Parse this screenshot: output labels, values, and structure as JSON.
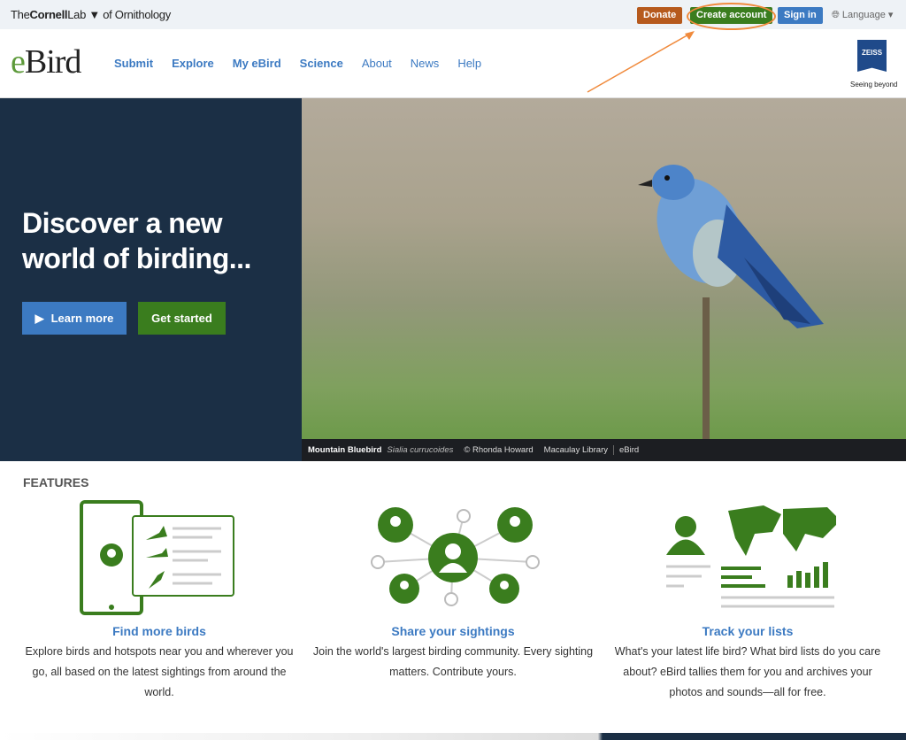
{
  "topbar": {
    "org_pre": "The",
    "org_bold": "Cornell",
    "org_lab": "Lab",
    "org_post": "of Ornithology",
    "donate": "Donate",
    "create_account": "Create account",
    "sign_in": "Sign in",
    "language": "Language"
  },
  "header": {
    "logo_e": "e",
    "logo_rest": "Bird",
    "nav": [
      "Submit",
      "Explore",
      "My eBird",
      "Science",
      "About",
      "News",
      "Help"
    ],
    "sponsor": "ZEISS",
    "sponsor_tagline": "Seeing beyond"
  },
  "hero": {
    "title_line1": "Discover a new",
    "title_line2": "world of birding...",
    "learn_more": "Learn more",
    "get_started": "Get started",
    "caption": {
      "common_name": "Mountain Bluebird",
      "scientific_name": "Sialia currucoides",
      "credit": "© Rhonda Howard",
      "library": "Macaulay Library",
      "source": "eBird"
    }
  },
  "features": {
    "heading": "FEATURES",
    "items": [
      {
        "title": "Find more birds",
        "text": "Explore birds and hotspots near you and wherever you go, all based on the latest sightings from around the world."
      },
      {
        "title": "Share your sightings",
        "text": "Join the world's largest birding community. Every sighting matters. Contribute yours."
      },
      {
        "title": "Track your lists",
        "text": "What's your latest life bird? What bird lists do you care about? eBird tallies them for you and archives your photos and sounds—all for free."
      }
    ]
  },
  "colors": {
    "brand_green": "#3a7d1e",
    "brand_blue": "#3c7ac2",
    "donate": "#b65a1d",
    "hero_dark": "#1b2f45",
    "annotation": "#f08a3c"
  }
}
